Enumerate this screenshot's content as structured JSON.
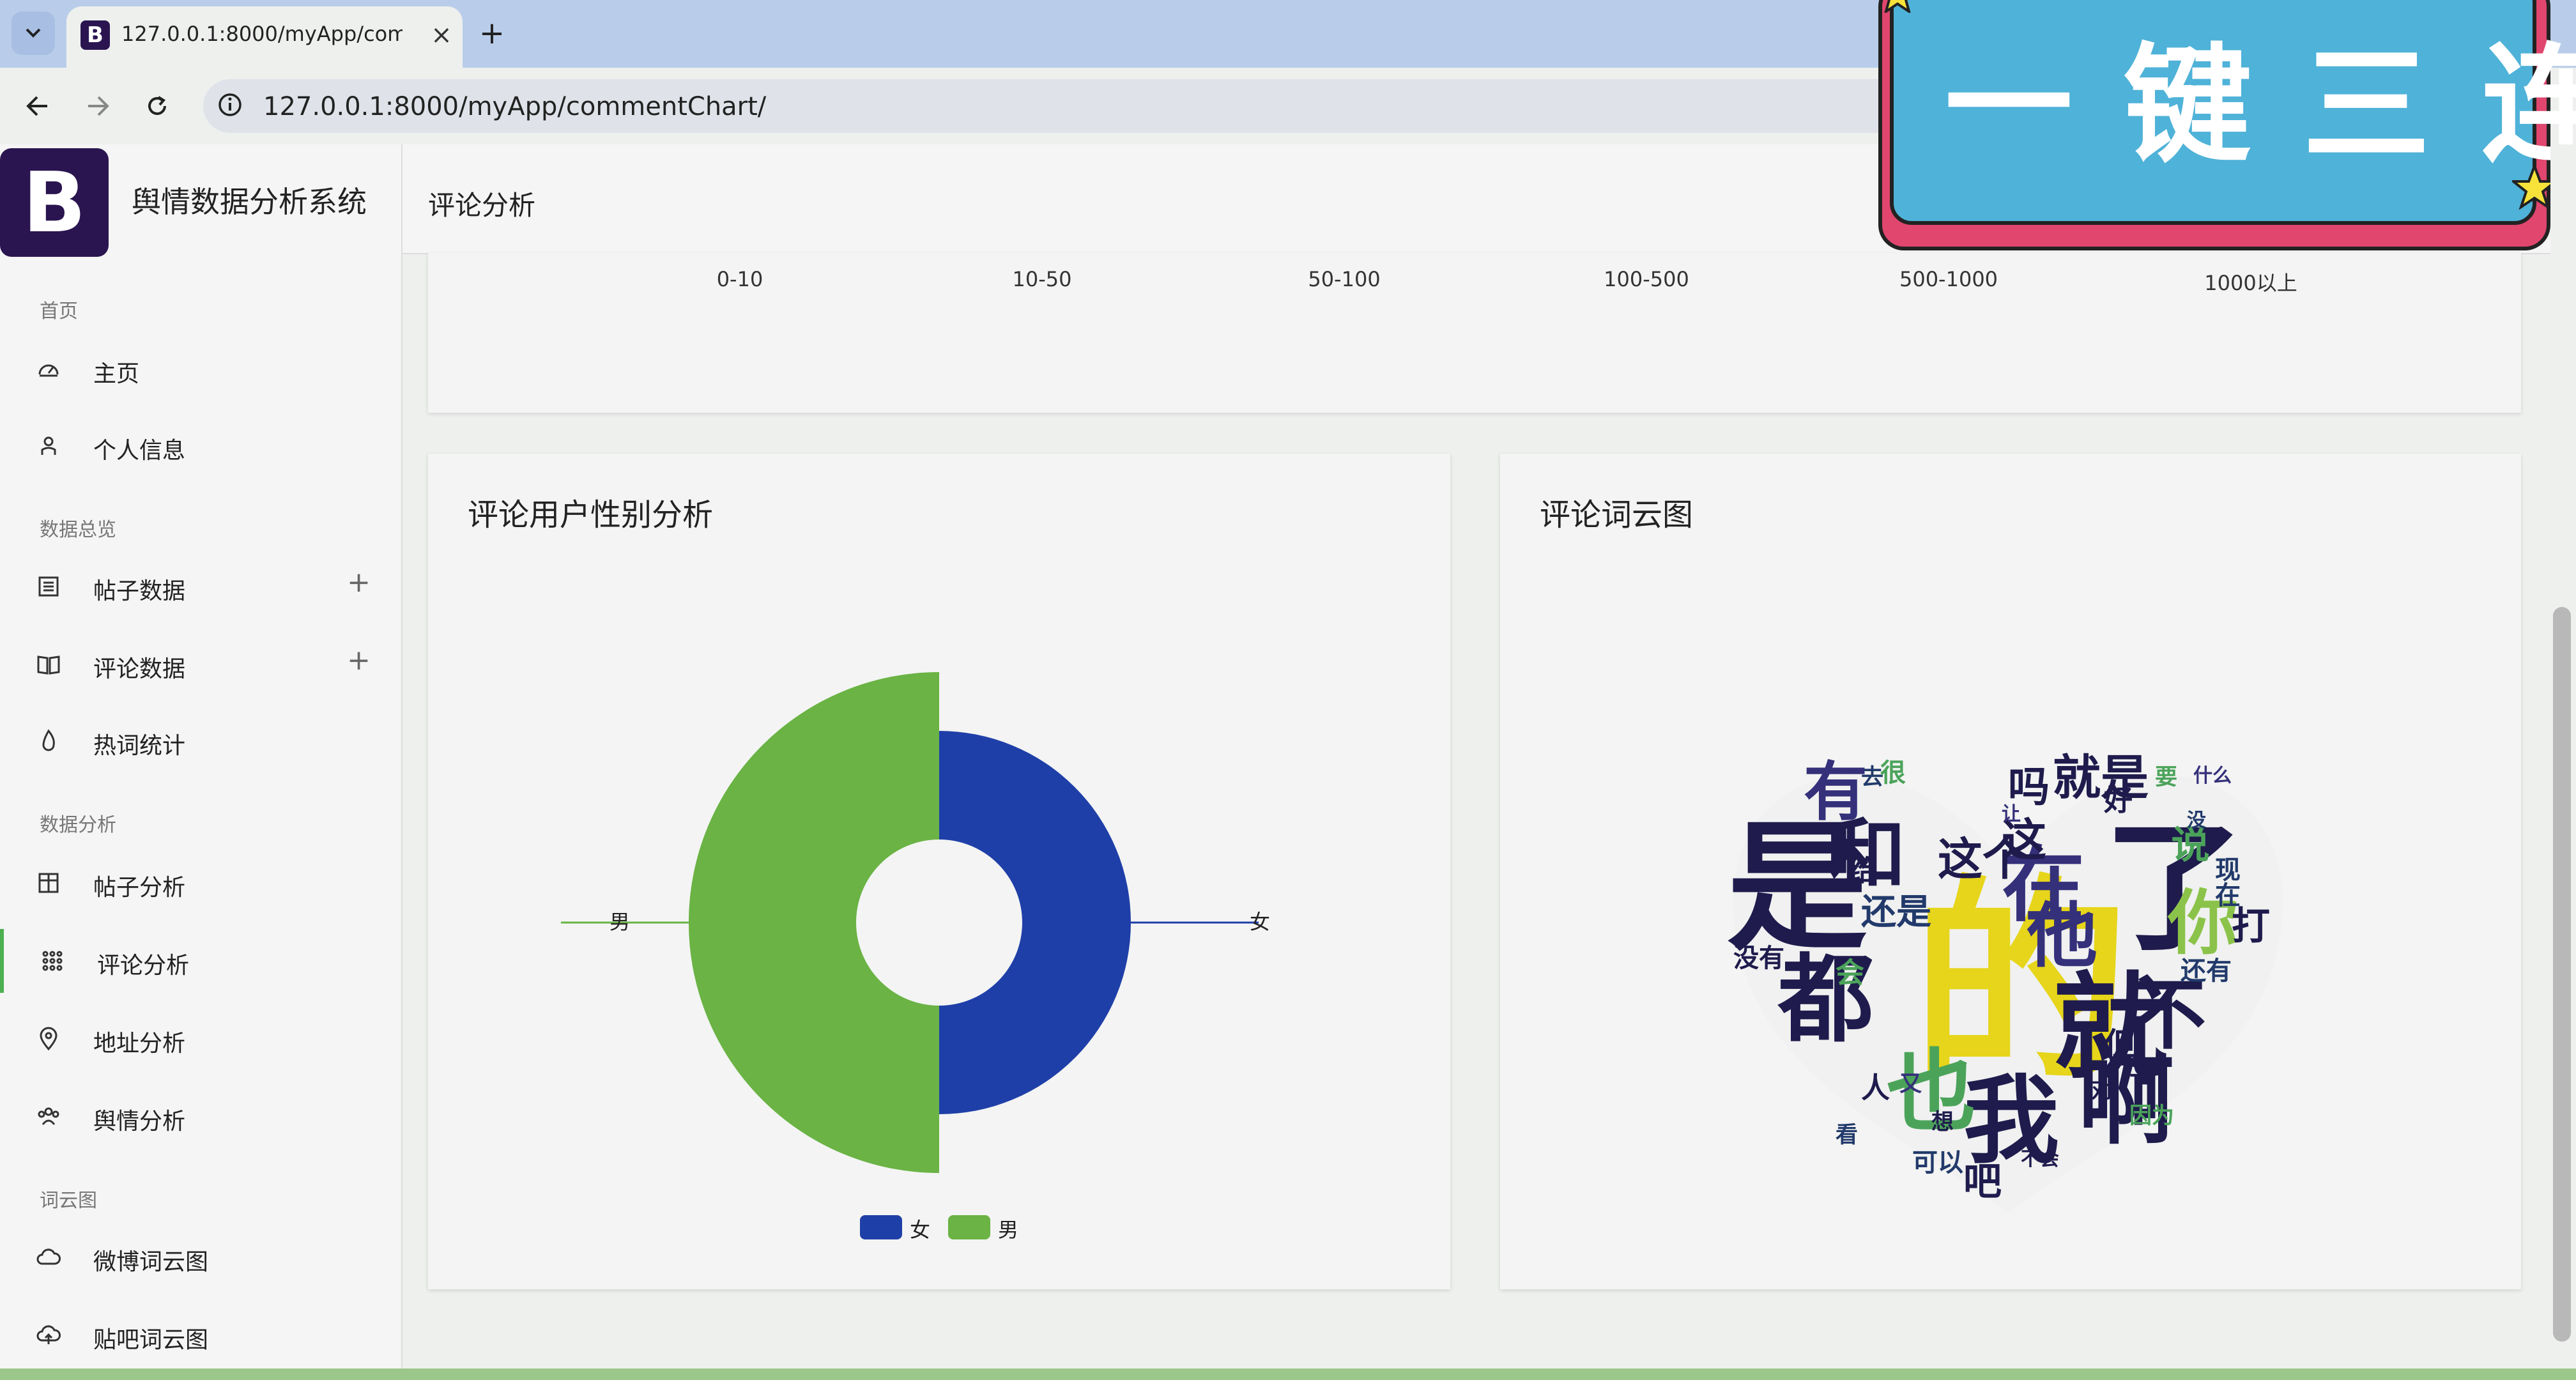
{
  "browser": {
    "tab_title": "127.0.0.1:8000/myApp/commentChart/",
    "url": "127.0.0.1:8000/myApp/commentChart/",
    "favicon_letter": "B",
    "new_tab": "+",
    "close_tab": "×"
  },
  "sidebar": {
    "logo_letter": "B",
    "brand": "舆情数据分析系统",
    "sections": [
      "首页",
      "数据总览",
      "数据分析",
      "词云图"
    ],
    "items": [
      {
        "label": "主页",
        "icon": "dashboard-icon"
      },
      {
        "label": "个人信息",
        "icon": "user-icon"
      },
      {
        "label": "帖子数据",
        "icon": "list-icon",
        "expand": "+"
      },
      {
        "label": "评论数据",
        "icon": "book-icon",
        "expand": "+"
      },
      {
        "label": "热词统计",
        "icon": "flame-icon"
      },
      {
        "label": "帖子分析",
        "icon": "columns-icon"
      },
      {
        "label": "评论分析",
        "icon": "grid-icon"
      },
      {
        "label": "地址分析",
        "icon": "location-pin-icon"
      },
      {
        "label": "舆情分析",
        "icon": "people-icon"
      },
      {
        "label": "微博词云图",
        "icon": "cloud-icon"
      },
      {
        "label": "贴吧词云图",
        "icon": "cloud-upload-icon"
      }
    ]
  },
  "header": {
    "title": "评论分析"
  },
  "top_chart": {
    "x_ticks": [
      "0-10",
      "10-50",
      "50-100",
      "100-500",
      "500-1000",
      "1000以上"
    ]
  },
  "gender_card": {
    "title": "评论用户性别分析"
  },
  "cloud_card": {
    "title": "评论词云图",
    "words": [
      "的",
      "是",
      "了",
      "我",
      "都",
      "就",
      "啊",
      "也",
      "在",
      "和",
      "有",
      "不",
      "你",
      "他",
      "这个",
      "就是",
      "吗",
      "这",
      "还是",
      "没有",
      "说",
      "打",
      "上",
      "人",
      "可以",
      "吧",
      "不会",
      "但",
      "对",
      "因为",
      "会",
      "还有",
      "没",
      "什么",
      "现在",
      "又",
      "给",
      "去",
      "让",
      "好",
      "很",
      "想",
      "看",
      "要"
    ]
  },
  "chart_data": {
    "type": "pie",
    "subtype": "rose",
    "categories": [
      "女",
      "男"
    ],
    "values": [
      48,
      52
    ],
    "colors": [
      "#1f3fa8",
      "#6ab344"
    ],
    "legend": [
      "女",
      "男"
    ],
    "legend_position": "bottom"
  },
  "promo": {
    "text": "一键三连"
  }
}
